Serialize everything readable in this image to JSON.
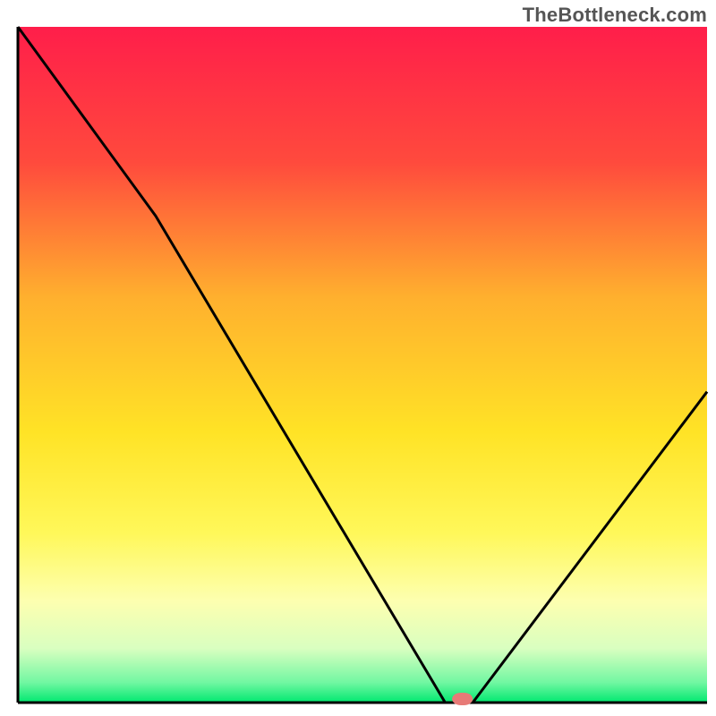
{
  "attribution": "TheBottleneck.com",
  "chart_data": {
    "type": "line",
    "title": "",
    "xlabel": "",
    "ylabel": "",
    "xlim": [
      0,
      100
    ],
    "ylim": [
      0,
      100
    ],
    "grid": false,
    "legend": false,
    "annotations": [],
    "series": [
      {
        "name": "curve",
        "x": [
          0,
          20,
          62,
          66,
          100
        ],
        "values": [
          100,
          72,
          0,
          0,
          46
        ]
      }
    ],
    "sweet_spot": {
      "x_start": 63,
      "x_end": 66,
      "y": 0
    },
    "gradient_bands": [
      {
        "stop": 0.0,
        "color": "#ff1e4a"
      },
      {
        "stop": 0.2,
        "color": "#ff4a3d"
      },
      {
        "stop": 0.4,
        "color": "#ffb02e"
      },
      {
        "stop": 0.6,
        "color": "#ffe326"
      },
      {
        "stop": 0.75,
        "color": "#fff85a"
      },
      {
        "stop": 0.85,
        "color": "#fdffb0"
      },
      {
        "stop": 0.92,
        "color": "#d9ffc0"
      },
      {
        "stop": 0.97,
        "color": "#72f7a2"
      },
      {
        "stop": 1.0,
        "color": "#00e870"
      }
    ],
    "marker": {
      "color": "#e77a77",
      "rx": 10
    },
    "axis": {
      "color": "#000000",
      "width": 3
    },
    "curve_style": {
      "color": "#000000",
      "width": 3
    }
  }
}
